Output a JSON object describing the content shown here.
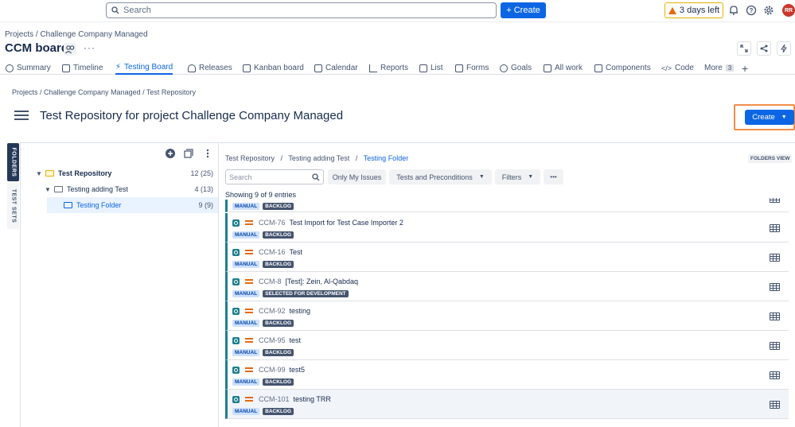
{
  "topnav": {
    "search_placeholder": "Search",
    "create_label": "+ Create",
    "trial_label": "3 days left",
    "avatar_initials": "RR",
    "icons": [
      "bell-icon",
      "help-icon",
      "gear-icon"
    ]
  },
  "project": {
    "breadcrumb": "Projects  /  Challenge Company Managed",
    "board_title": "CCM board",
    "more": "···"
  },
  "tabs": [
    {
      "label": "Summary",
      "icon": "globe-icon"
    },
    {
      "label": "Timeline",
      "icon": "timeline-icon"
    },
    {
      "label": "Testing Board",
      "icon": "bolt-icon",
      "active": true
    },
    {
      "label": "Releases",
      "icon": "ship-icon"
    },
    {
      "label": "Kanban board",
      "icon": "board-icon"
    },
    {
      "label": "Calendar",
      "icon": "calendar-icon"
    },
    {
      "label": "Reports",
      "icon": "chart-icon"
    },
    {
      "label": "List",
      "icon": "list-icon"
    },
    {
      "label": "Forms",
      "icon": "form-icon"
    },
    {
      "label": "Goals",
      "icon": "target-icon"
    },
    {
      "label": "All work",
      "icon": "work-icon"
    },
    {
      "label": "Components",
      "icon": "component-icon"
    },
    {
      "label": "Code",
      "icon": "code-icon"
    }
  ],
  "tabs_more": {
    "label": "More",
    "count": "3"
  },
  "repo": {
    "breadcrumb": "Projects  /  Challenge Company Managed  /  Test Repository",
    "title": "Test Repository for project Challenge Company Managed",
    "create_label": "Create"
  },
  "side_tabs": {
    "folders": "FOLDERS",
    "test_sets": "TEST SETS"
  },
  "tree": [
    {
      "label": "Test Repository",
      "count": "12 (25)"
    },
    {
      "label": "Testing adding Test",
      "count": "4 (13)"
    },
    {
      "label": "Testing Folder",
      "count": "9 (9)"
    }
  ],
  "content": {
    "crumb_a": "Test Repository",
    "crumb_b": "Testing adding Test",
    "crumb_c": "Testing Folder",
    "folders_view": "FOLDERS VIEW",
    "search_placeholder": "Search",
    "filter_my": "Only My Issues",
    "filter_type": "Tests and Preconditions",
    "filter_filters": "Filters",
    "filter_more": "•••",
    "showing": "Showing 9 of 9 entries"
  },
  "tests": [
    {
      "key": "",
      "title": "",
      "type": "MANUAL",
      "status": "BACKLOG",
      "partial": true
    },
    {
      "key": "CCM-76",
      "title": "Test Import for Test Case Importer 2",
      "type": "MANUAL",
      "status": "BACKLOG"
    },
    {
      "key": "CCM-16",
      "title": "Test",
      "type": "MANUAL",
      "status": "BACKLOG"
    },
    {
      "key": "CCM-8",
      "title": "[Test]: Zein, Al-Qabdaq",
      "type": "MANUAL",
      "status": "SELECTED FOR DEVELOPMENT"
    },
    {
      "key": "CCM-92",
      "title": "testing",
      "type": "MANUAL",
      "status": "BACKLOG"
    },
    {
      "key": "CCM-95",
      "title": "test",
      "type": "MANUAL",
      "status": "BACKLOG"
    },
    {
      "key": "CCM-99",
      "title": "test5",
      "type": "MANUAL",
      "status": "BACKLOG"
    },
    {
      "key": "CCM-101",
      "title": "testing TRR",
      "type": "MANUAL",
      "status": "BACKLOG",
      "highlight": true
    }
  ]
}
